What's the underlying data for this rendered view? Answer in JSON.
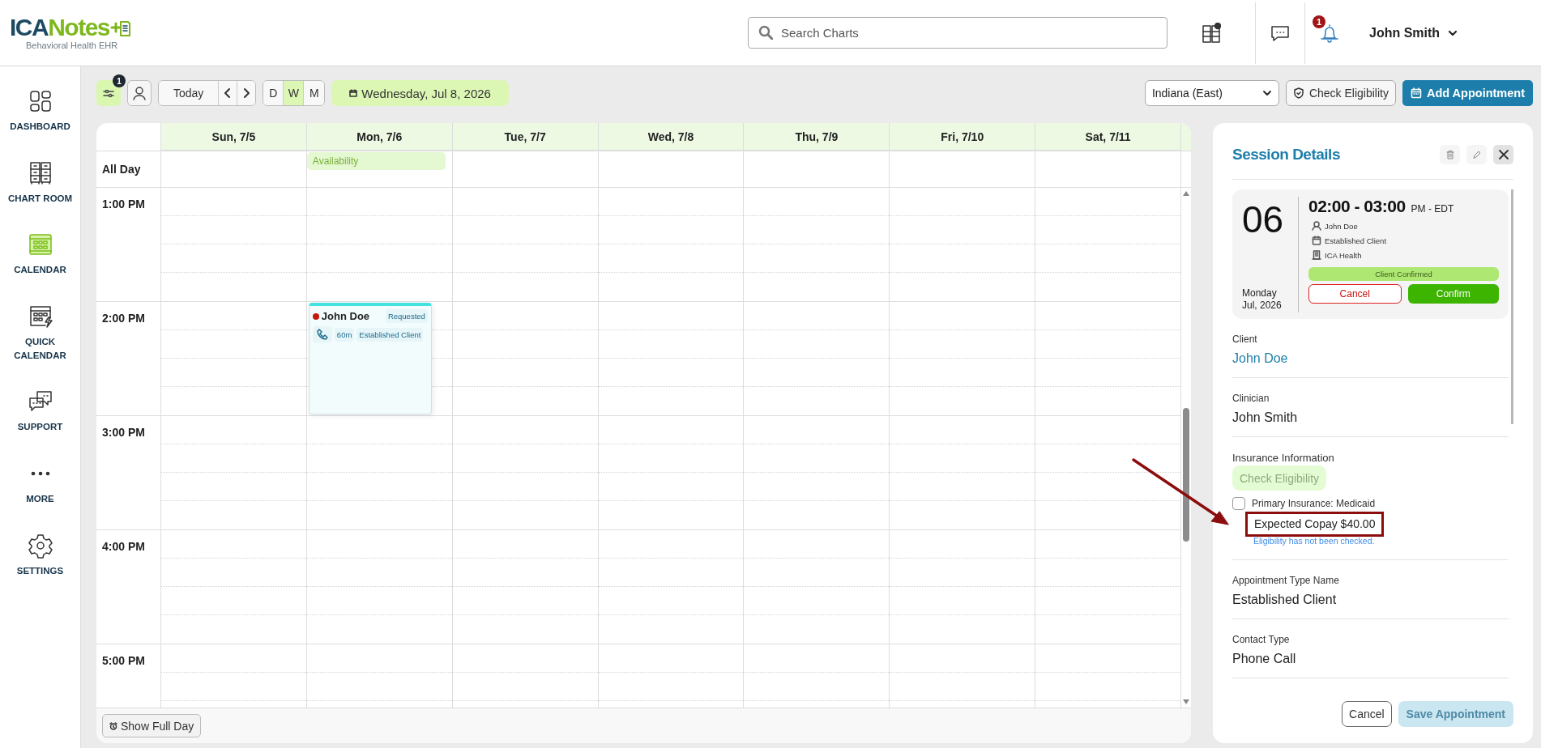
{
  "header": {
    "logo": {
      "name": "ICANotes",
      "tagline": "Behavioral Health EHR"
    },
    "search": {
      "placeholder": "Search Charts"
    },
    "notifications": {
      "count": "1"
    },
    "user": {
      "name": "John Smith"
    }
  },
  "sidebar": {
    "items": [
      {
        "kind": "dashboard",
        "label": "DASHBOARD",
        "selected": false
      },
      {
        "kind": "chart-room",
        "label": "CHART ROOM",
        "selected": false
      },
      {
        "kind": "calendar",
        "label": "CALENDAR",
        "selected": true
      },
      {
        "kind": "quick-calendar",
        "label": "QUICK CALENDAR",
        "selected": false
      },
      {
        "kind": "support",
        "label": "SUPPORT",
        "selected": false
      },
      {
        "kind": "more",
        "label": "MORE",
        "selected": false
      },
      {
        "kind": "settings",
        "label": "SETTINGS",
        "selected": false
      }
    ]
  },
  "toolbar": {
    "filter": {
      "badge": "1",
      "active": true
    },
    "today": "Today",
    "views": [
      {
        "label": "D",
        "selected": false
      },
      {
        "label": "W",
        "selected": true
      },
      {
        "label": "M",
        "selected": false
      }
    ],
    "date": "Wednesday, Jul 8, 2026",
    "timezone": "Indiana (East)",
    "check_eligibility": "Check Eligibility",
    "add_appointment": "Add Appointment"
  },
  "calendar": {
    "all_day_label": "All Day",
    "days": [
      {
        "label": "Sun, 7/5"
      },
      {
        "label": "Mon, 7/6",
        "all_day": [
          "Availability"
        ],
        "events": [
          {
            "name": "John Doe",
            "color": "#c0190c",
            "status": "Requested",
            "duration": "60m",
            "type": "Established Client"
          }
        ]
      },
      {
        "label": "Tue, 7/7"
      },
      {
        "label": "Wed, 7/8"
      },
      {
        "label": "Thu, 7/9"
      },
      {
        "label": "Fri, 7/10"
      },
      {
        "label": "Sat, 7/11"
      }
    ],
    "hours": [
      {
        "label": "1:00 PM"
      },
      {
        "label": "2:00 PM"
      },
      {
        "label": "3:00 PM"
      },
      {
        "label": "4:00 PM"
      },
      {
        "label": "5:00 PM"
      }
    ],
    "show_full_day": "Show Full Day"
  },
  "session": {
    "title": "Session Details",
    "summary": {
      "day": "06",
      "weekday": "Monday",
      "month_year": "Jul, 2026",
      "time": "02:00 - 03:00",
      "zone": "PM - EDT",
      "details": [
        {
          "kind": "client",
          "text": "John Doe"
        },
        {
          "kind": "appointment-type",
          "text": "Established Client"
        },
        {
          "kind": "location",
          "text": "ICA Health"
        }
      ],
      "status": "Client Confirmed",
      "cancel": "Cancel",
      "confirm": "Confirm"
    },
    "fields": [
      {
        "label": "Client",
        "value": "John Doe",
        "link": true
      },
      {
        "label": "Clinician",
        "value": "John Smith",
        "link": false
      }
    ],
    "insurance": {
      "label": "Insurance Information",
      "check_eligibility": "Check Eligibility",
      "primary": {
        "text": "Primary Insurance: Medicaid",
        "checked": false
      },
      "copay": {
        "text": "Expected Copay $40.00",
        "highlighted": true
      },
      "eligibility_note": "Eligibility has not been checked."
    },
    "more_fields": [
      {
        "label": "Appointment Type Name",
        "value": "Established Client",
        "link": false
      },
      {
        "label": "Contact Type",
        "value": "Phone Call",
        "link": false
      }
    ],
    "cancel": "Cancel",
    "save": {
      "label": "Save Appointment",
      "disabled": true
    }
  }
}
